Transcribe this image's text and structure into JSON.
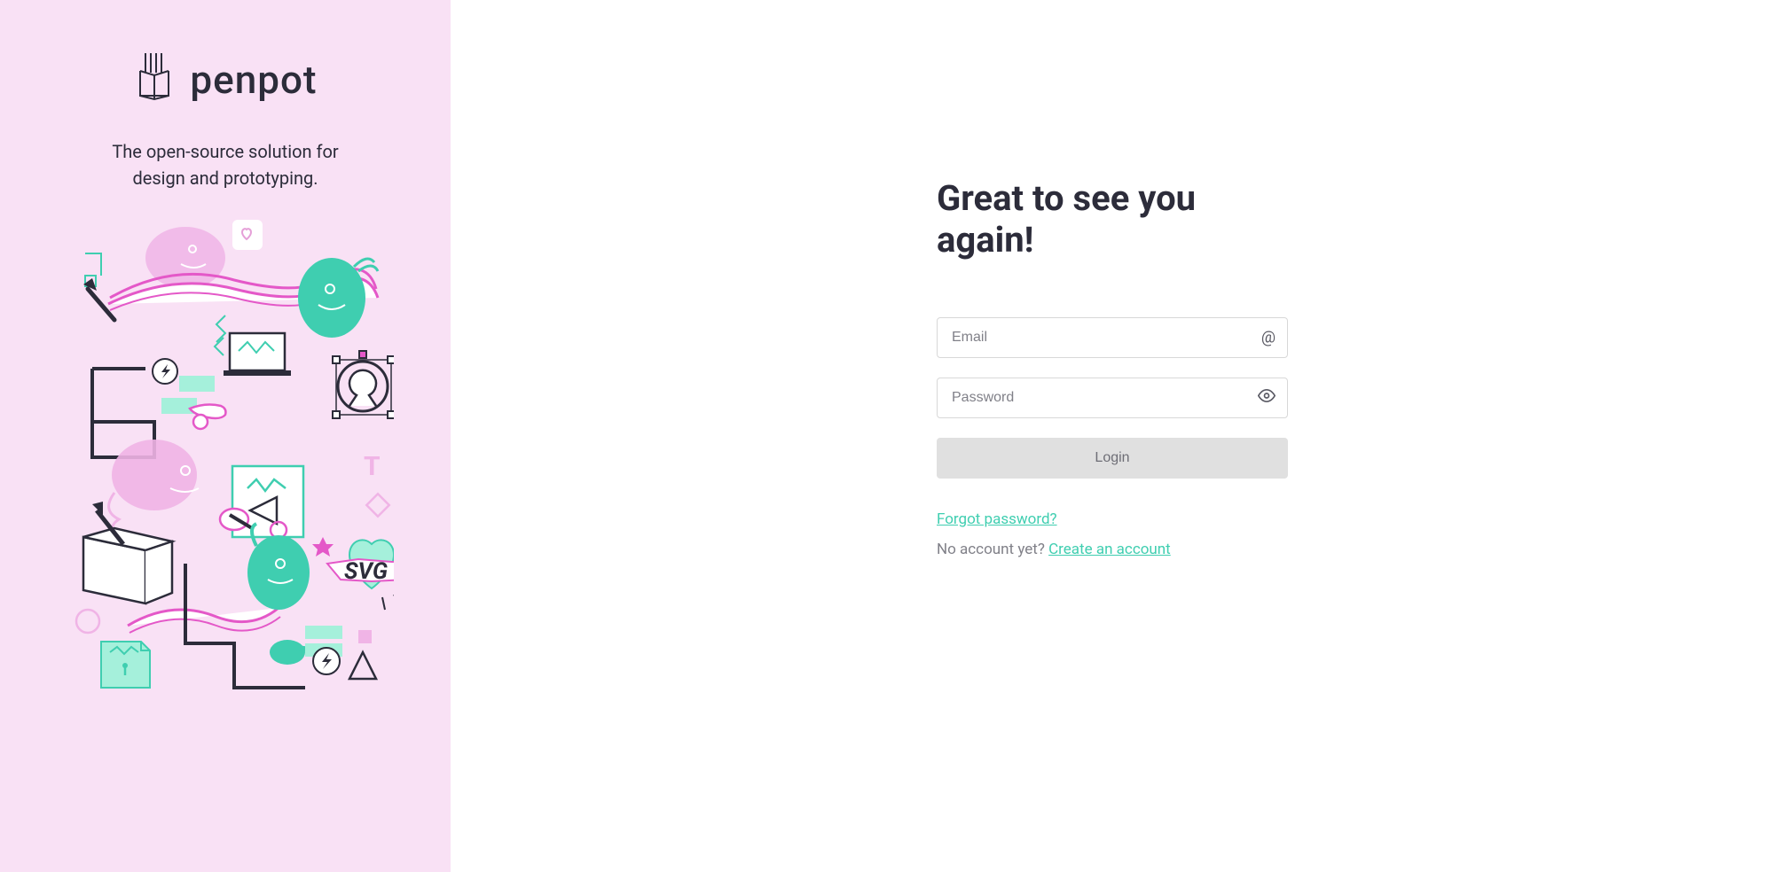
{
  "sidebar": {
    "brand": "penpot",
    "tagline_line1": "The open-source solution for",
    "tagline_line2": "design and prototyping."
  },
  "main": {
    "heading": "Great to see you again!",
    "email_placeholder": "Email",
    "password_placeholder": "Password",
    "login_label": "Login",
    "forgot_password": "Forgot password?",
    "no_account_text": "No account yet? ",
    "create_account": "Create an account"
  },
  "colors": {
    "sidebar_bg": "#f9e1f5",
    "accent": "#3fceb0",
    "text_dark": "#2c2c3a",
    "text_muted": "#808088"
  }
}
